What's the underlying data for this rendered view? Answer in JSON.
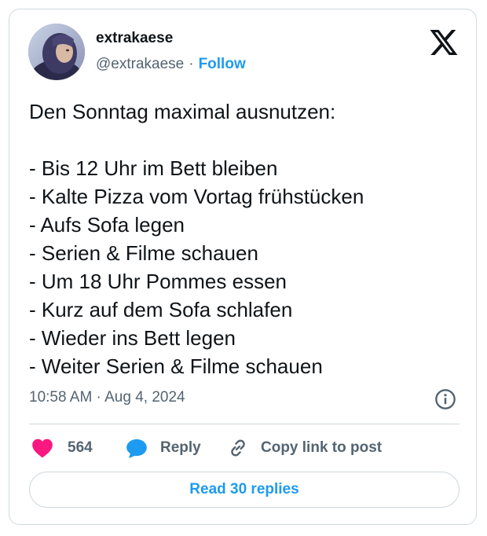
{
  "author": {
    "display_name": "extrakaese",
    "handle": "@extrakaese",
    "separator": "·",
    "follow_label": "Follow"
  },
  "platform_logo": "x-logo-icon",
  "tweet": {
    "intro": "Den Sonntag maximal ausnutzen:",
    "items": [
      "- Bis 12 Uhr im Bett bleiben",
      "- Kalte Pizza vom Vortag frühstücken",
      "- Aufs Sofa legen",
      "- Serien & Filme schauen",
      "- Um 18 Uhr Pommes essen",
      "- Kurz auf dem Sofa schlafen",
      "- Wieder ins Bett legen",
      "- Weiter Serien & Filme schauen"
    ]
  },
  "meta": {
    "timestamp": "10:58 AM · Aug 4, 2024",
    "info_icon": "info-icon"
  },
  "actions": {
    "like_count": "564",
    "reply_label": "Reply",
    "copy_label": "Copy link to post"
  },
  "read_replies_label": "Read 30 replies",
  "colors": {
    "accent": "#1d9bf0",
    "like": "#f91880",
    "text_primary": "#0f1419",
    "text_secondary": "#536471",
    "border": "#cfd9de"
  }
}
